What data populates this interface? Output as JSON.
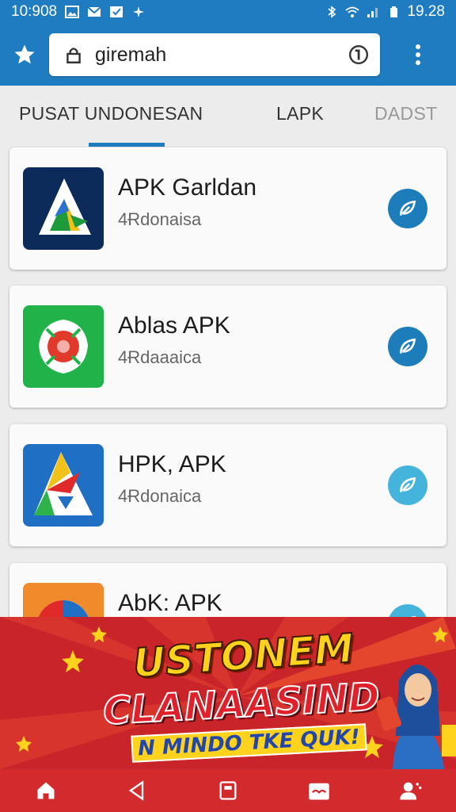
{
  "status_bar": {
    "time_left": "10:908",
    "time_right": "19.28"
  },
  "browser": {
    "url_text": "giremah"
  },
  "tabs": [
    {
      "label": "PUSAT UNDONESAN"
    },
    {
      "label": "LAPK"
    },
    {
      "label": "DADST"
    }
  ],
  "apps": [
    {
      "name": "APK Garldan",
      "subtitle": "4Ɍdonaisa",
      "button_color": "#1d7dbb"
    },
    {
      "name": "Ablas APK",
      "subtitle": "4Ɍdaaaica",
      "button_color": "#1d7dbb"
    },
    {
      "name": "HPK, APK",
      "subtitle": "4Ɍdonaica",
      "button_color": "#45b4dd"
    },
    {
      "name": "AbK: APK",
      "subtitle": "",
      "button_color": "#45b4dd"
    }
  ],
  "banner": {
    "line1": "USTONEM",
    "line2": "CLANAASIND",
    "line3": "N MINDO TKE QUK!"
  },
  "colors": {
    "toolbar": "#1f7cc0",
    "banner": "#c8242a",
    "bottom_nav": "#d32a2e"
  },
  "icons": [
    "star-icon",
    "lock-icon",
    "info-icon",
    "more-vert-icon",
    "home-icon",
    "back-icon",
    "tabs-icon",
    "gift-icon",
    "profile-icon"
  ]
}
